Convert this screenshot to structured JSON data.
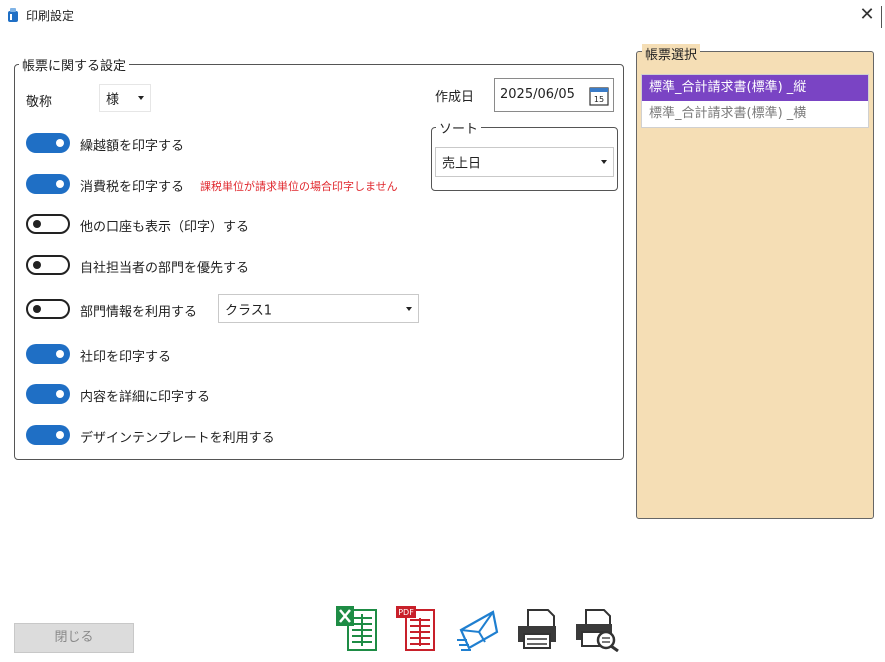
{
  "window": {
    "title": "印刷設定"
  },
  "form_settings": {
    "legend": "帳票に関する設定",
    "honorific": {
      "label": "敬称",
      "value": "様"
    },
    "created_date": {
      "label": "作成日",
      "value": "2025/06/05",
      "calendar_day": "15"
    },
    "sort": {
      "legend": "ソート",
      "value": "売上日"
    },
    "toggles": [
      {
        "label": "繰越額を印字する",
        "on": true
      },
      {
        "label": "消費税を印字する",
        "on": true,
        "note": "課税単位が請求単位の場合印字しません"
      },
      {
        "label": "他の口座も表示（印字）する",
        "on": false
      },
      {
        "label": "自社担当者の部門を優先する",
        "on": false
      },
      {
        "label": "部門情報を利用する",
        "on": false,
        "select_value": "クラス1"
      },
      {
        "label": "社印を印字する",
        "on": true
      },
      {
        "label": "内容を詳細に印字する",
        "on": true
      },
      {
        "label": "デザインテンプレートを利用する",
        "on": true
      }
    ]
  },
  "form_select": {
    "legend": "帳票選択",
    "items": [
      {
        "label": "標準_合計請求書(標準) _縦",
        "selected": true
      },
      {
        "label": "標準_合計請求書(標準) _横",
        "selected": false
      }
    ]
  },
  "footer": {
    "close_label": "閉じる",
    "pdf_badge": "PDF",
    "export_icons": [
      "excel-export-icon",
      "pdf-export-icon",
      "email-send-icon",
      "print-icon",
      "print-preview-icon"
    ]
  },
  "colors": {
    "accent": "#1f6fc5",
    "selected_item": "#7a44c4",
    "warning": "#e0282e",
    "side_panel": "#f5deb5"
  }
}
